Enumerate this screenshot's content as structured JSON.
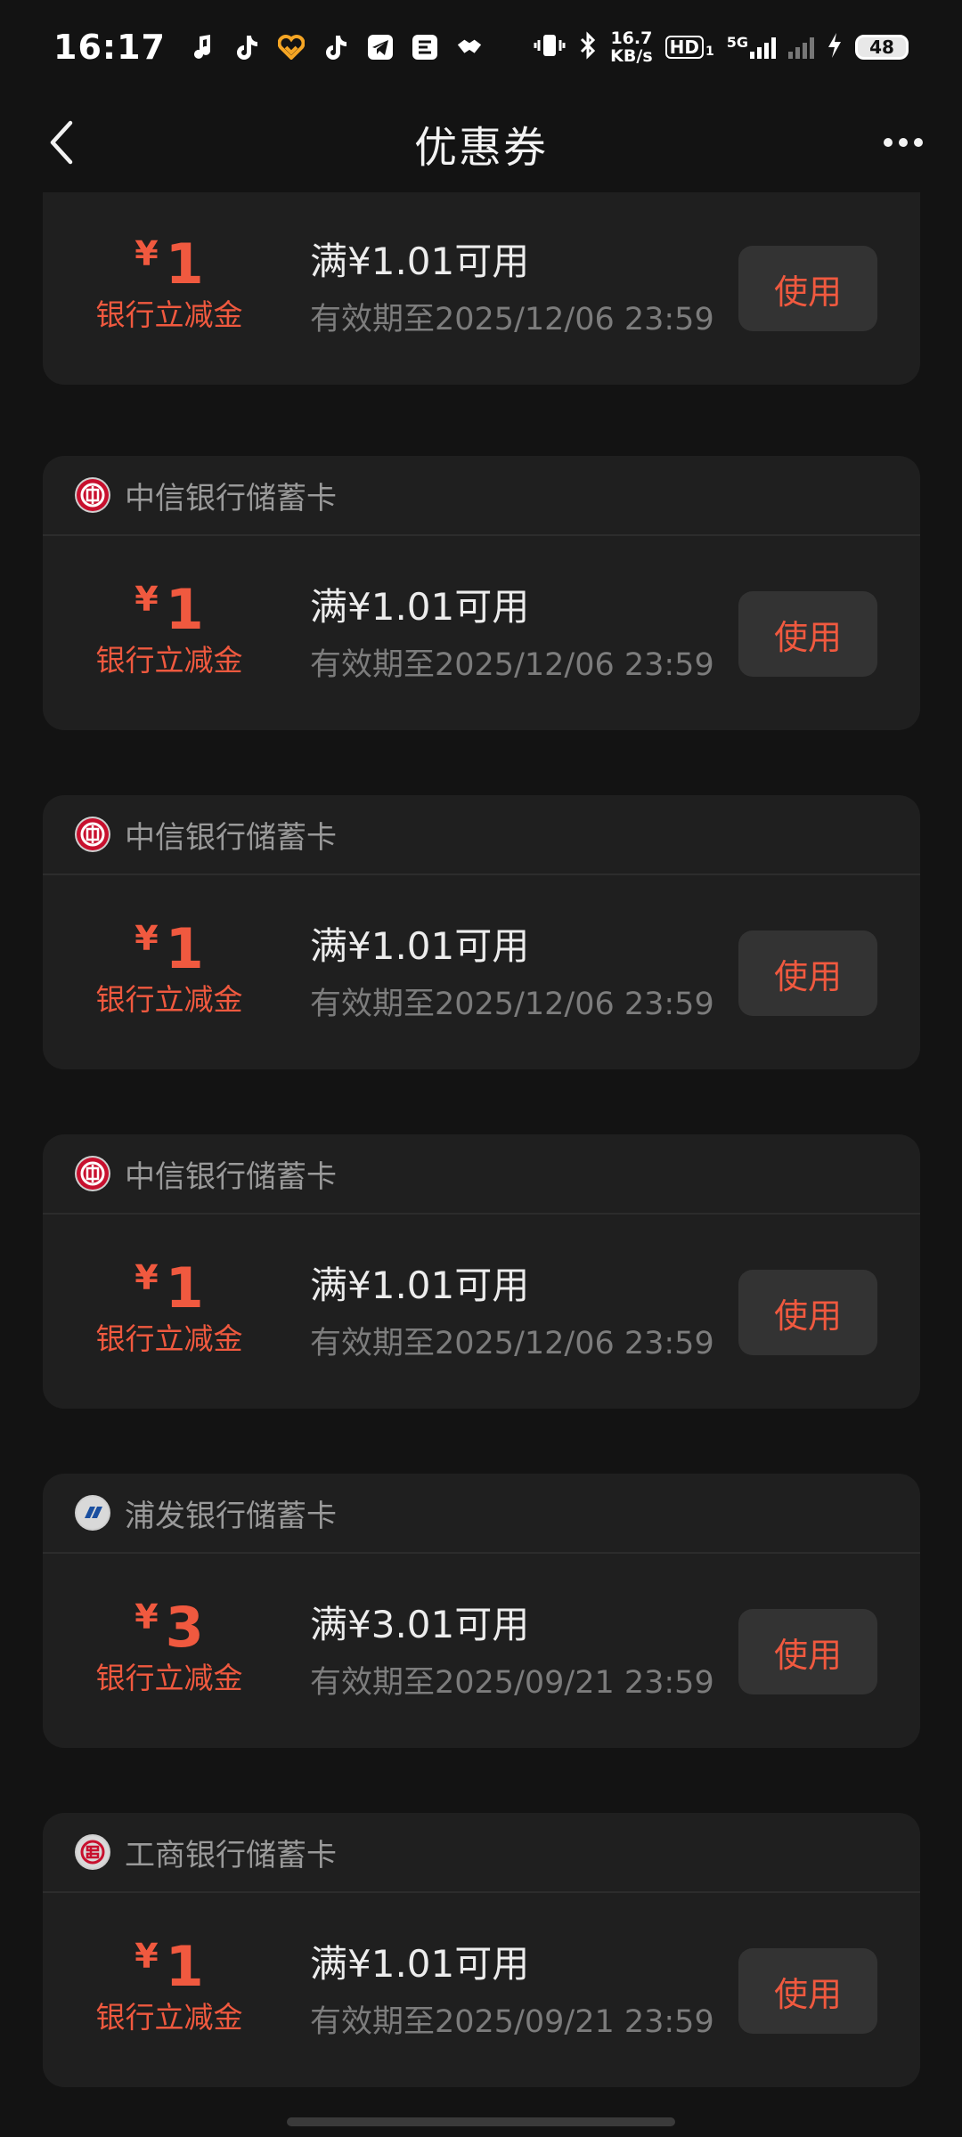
{
  "status_bar": {
    "time": "16:17",
    "app_icons": [
      "music-note-icon",
      "tiktok-icon",
      "heart-app-icon",
      "tiktok-icon",
      "telegram-icon",
      "video-app-icon",
      "handshake-icon"
    ],
    "net_speed_value": "16.7",
    "net_speed_unit": "KB/s",
    "hd_label": "HD",
    "hd_sub": "1",
    "network_type": "5G",
    "battery": "48"
  },
  "header": {
    "title": "优惠券"
  },
  "coupons": [
    {
      "bank": "",
      "logo": "citic-bank-logo",
      "amount": "1",
      "currency": "¥",
      "label": "银行立减金",
      "condition": "满¥1.01可用",
      "validity": "有效期至2025/12/06 23:59",
      "button": "使用"
    },
    {
      "bank": "中信银行储蓄卡",
      "logo": "citic-bank-logo",
      "amount": "1",
      "currency": "¥",
      "label": "银行立减金",
      "condition": "满¥1.01可用",
      "validity": "有效期至2025/12/06 23:59",
      "button": "使用"
    },
    {
      "bank": "中信银行储蓄卡",
      "logo": "citic-bank-logo",
      "amount": "1",
      "currency": "¥",
      "label": "银行立减金",
      "condition": "满¥1.01可用",
      "validity": "有效期至2025/12/06 23:59",
      "button": "使用"
    },
    {
      "bank": "中信银行储蓄卡",
      "logo": "citic-bank-logo",
      "amount": "1",
      "currency": "¥",
      "label": "银行立减金",
      "condition": "满¥1.01可用",
      "validity": "有效期至2025/12/06 23:59",
      "button": "使用"
    },
    {
      "bank": "浦发银行储蓄卡",
      "logo": "spdb-bank-logo",
      "amount": "3",
      "currency": "¥",
      "label": "银行立减金",
      "condition": "满¥3.01可用",
      "validity": "有效期至2025/09/21 23:59",
      "button": "使用"
    },
    {
      "bank": "工商银行储蓄卡",
      "logo": "icbc-bank-logo",
      "amount": "1",
      "currency": "¥",
      "label": "银行立减金",
      "condition": "满¥1.01可用",
      "validity": "有效期至2025/09/21 23:59",
      "button": "使用"
    }
  ],
  "colors": {
    "background": "#131313",
    "card": "#1f1f1f",
    "accent": "#f0593f",
    "button_bg": "#333333",
    "muted_text": "#7c7c7c"
  }
}
